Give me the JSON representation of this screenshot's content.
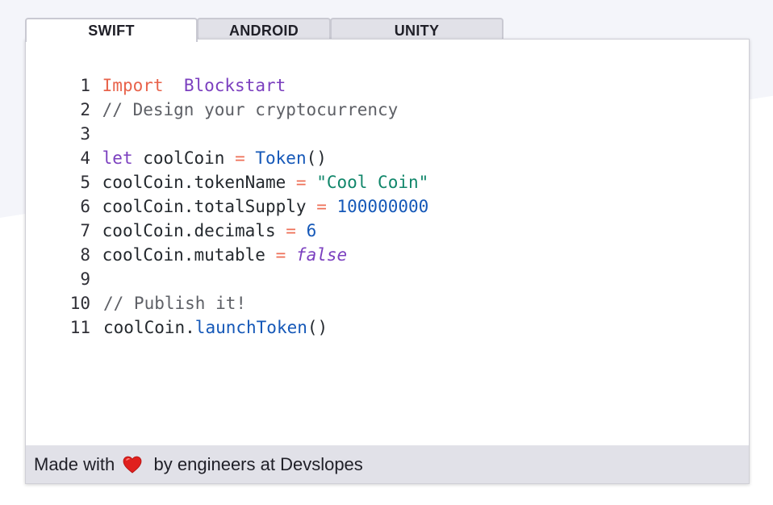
{
  "tabs": [
    {
      "label": "SWIFT",
      "active": true
    },
    {
      "label": "ANDROID",
      "active": false
    },
    {
      "label": "UNITY",
      "active": false
    }
  ],
  "code": {
    "line_numbers": [
      "1",
      "2",
      "3",
      "4",
      "5",
      "6",
      "7",
      "8",
      "9",
      "10",
      "11"
    ],
    "l1": {
      "keyword": "Import",
      "module": "Blockstart"
    },
    "l2": {
      "comment": "// Design your cryptocurrency"
    },
    "l4": {
      "keyword": "let",
      "var": "coolCoin",
      "op": "=",
      "type": "Token",
      "parens": "()"
    },
    "l5": {
      "prop": "coolCoin.tokenName",
      "op": "=",
      "value": "\"Cool Coin\""
    },
    "l6": {
      "prop": "coolCoin.totalSupply",
      "op": "=",
      "value": "100000000"
    },
    "l7": {
      "prop": "coolCoin.decimals",
      "op": "=",
      "value": "6"
    },
    "l8": {
      "prop": "coolCoin.mutable",
      "op": "=",
      "value": "false"
    },
    "l10": {
      "comment": "// Publish it!"
    },
    "l11": {
      "obj": "coolCoin.",
      "method": "launchToken",
      "parens": "()"
    }
  },
  "footer": {
    "prefix": "Made with",
    "heart_icon": "heart-icon",
    "suffix": "by engineers at Devslopes"
  },
  "colors": {
    "keyword_import": "#e8634b",
    "keyword": "#7b3fbf",
    "operator": "#ee6f57",
    "type": "#1558b8",
    "string": "#10866a",
    "comment": "#5e6066",
    "heart": "#e0201e"
  }
}
